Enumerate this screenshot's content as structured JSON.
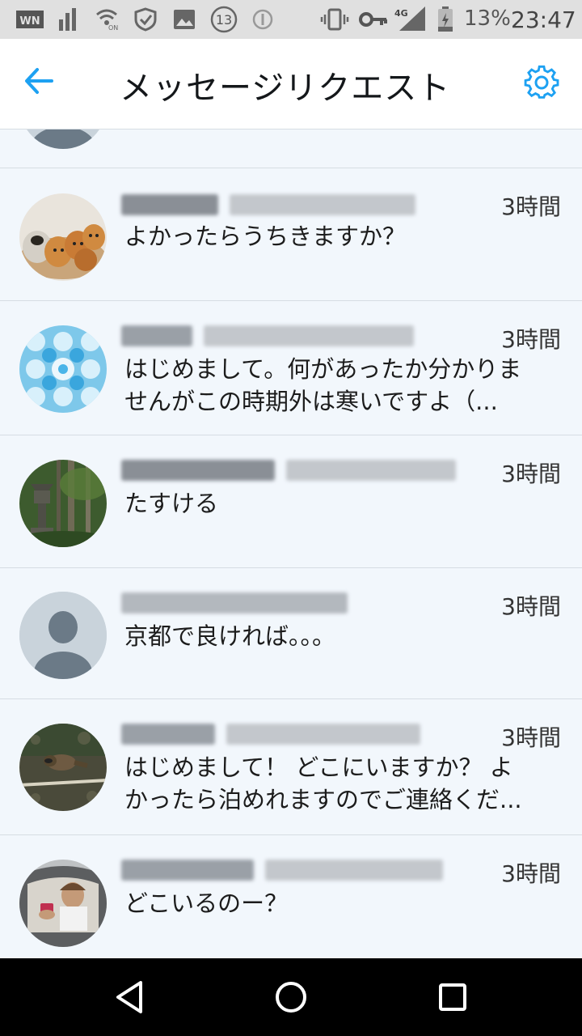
{
  "status_bar": {
    "network_label": "4G",
    "battery_percent": "13%",
    "time": "23:47",
    "notification_count": "13",
    "icons": [
      "app-icon",
      "signal-bars-icon",
      "wifi-calling-icon",
      "shield-icon",
      "image-icon",
      "notification-count-icon",
      "circle-icon",
      "vibrate-icon",
      "key-icon",
      "cell-signal-icon",
      "battery-icon"
    ]
  },
  "header": {
    "title": "メッセージリクエスト",
    "back_icon": "arrow-left-icon",
    "settings_icon": "gear-icon",
    "accent_color": "#1da1f2"
  },
  "requests": [
    {
      "time": "3時間",
      "message": "よかったらうちきますか？",
      "avatar": "kittens-photo"
    },
    {
      "time": "3時間",
      "message": "はじめまして。何があったか分かりませんがこの時期外は寒いですよ（...",
      "avatar": "blue-pattern"
    },
    {
      "time": "3時間",
      "message": "たすける",
      "avatar": "garden-lantern-photo"
    },
    {
      "time": "3時間",
      "message": "京都で良ければ。。。",
      "avatar": "default-profile"
    },
    {
      "time": "3時間",
      "message": "はじめまして！ どこにいますか？ よかったら泊めれますのでご連絡くだ...",
      "avatar": "raccoon-photo"
    },
    {
      "time": "3時間",
      "message": "どこいるのー？",
      "avatar": "car-selfie-photo"
    }
  ],
  "navigation": {
    "icons": [
      "back-triangle-icon",
      "home-circle-icon",
      "recents-square-icon"
    ]
  }
}
